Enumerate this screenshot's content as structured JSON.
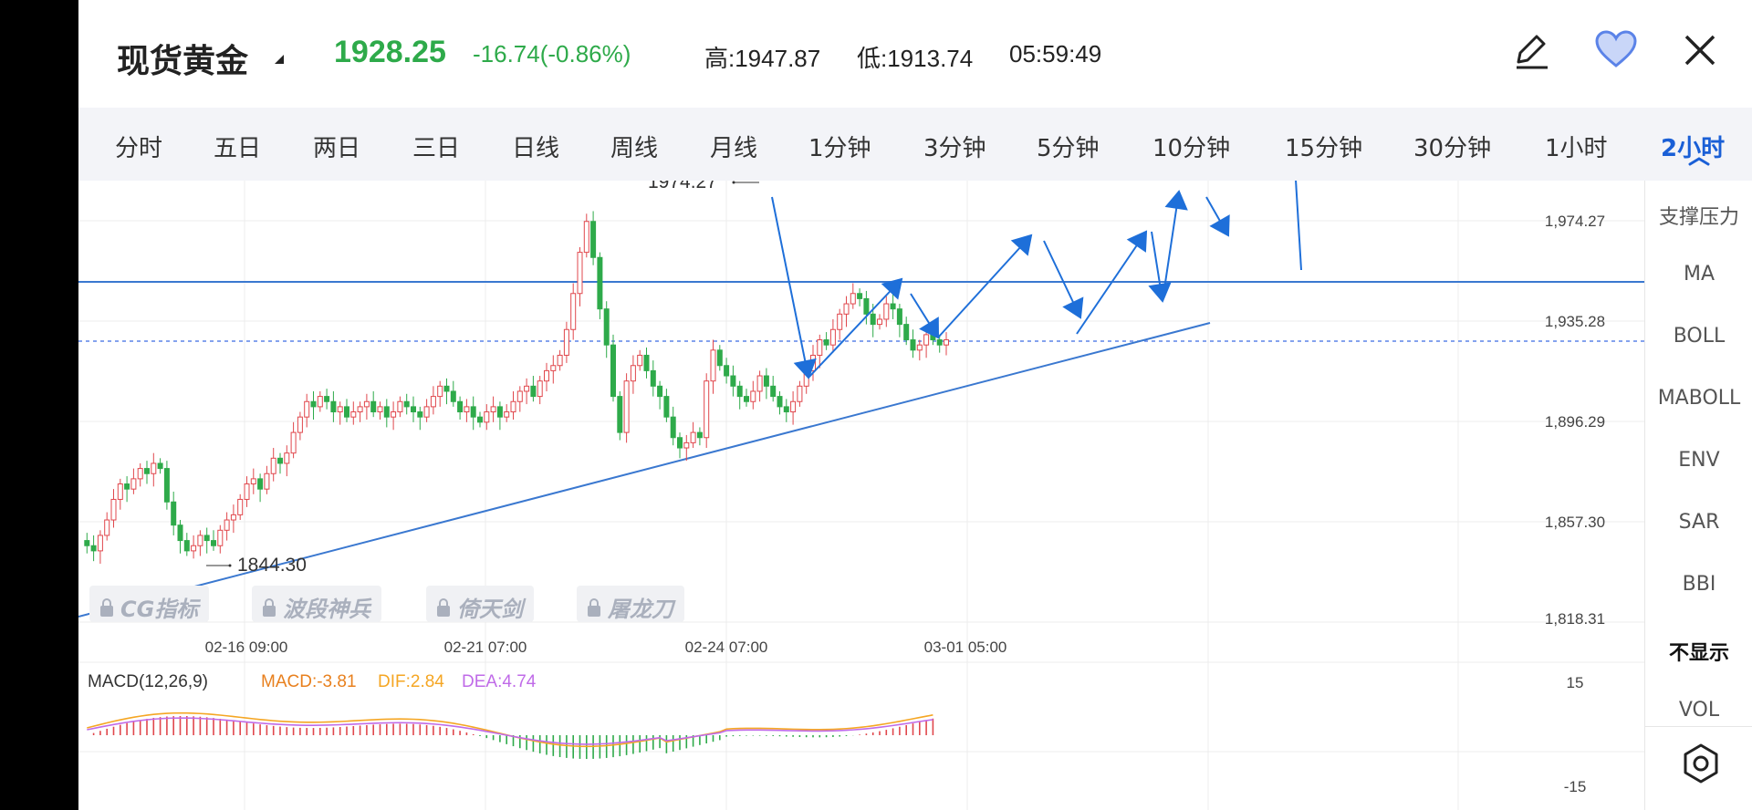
{
  "header": {
    "symbol": "现货黄金",
    "price": "1928.25",
    "change": "-16.74(-0.86%)",
    "high": "高:1947.87",
    "low": "低:1913.74",
    "time": "05:59:49",
    "icons": [
      "edit-icon",
      "heart-icon",
      "close-icon"
    ],
    "up_color": "#2eaa4a"
  },
  "tabs": [
    "分时",
    "五日",
    "两日",
    "三日",
    "日线",
    "周线",
    "月线",
    "1分钟",
    "3分钟",
    "5分钟",
    "10分钟",
    "15分钟",
    "30分钟",
    "1小时",
    "2小时"
  ],
  "active_tab": "2小时",
  "side_panel": [
    "支撑压力",
    "MA",
    "BOLL",
    "MABOLL",
    "ENV",
    "SAR",
    "BBI",
    "不显示",
    "VOL"
  ],
  "indicator_buttons": [
    "CG指标",
    "波段神兵",
    "倚天剑",
    "屠龙刀"
  ],
  "chart": {
    "y_ticks": [
      "1,974.27",
      "1,935.28",
      "1,896.29",
      "1,857.30",
      "1,818.31"
    ],
    "x_ticks": [
      "02-16 09:00",
      "02-21 07:00",
      "02-24 07:00",
      "03-01 05:00"
    ],
    "max_label": "1974.27",
    "min_label": "1844.30",
    "macd_legend": {
      "title": "MACD(12,26,9)",
      "macd": "MACD:-3.81",
      "dif": "DIF:2.84",
      "dea": "DEA:4.74"
    },
    "macd_ticks": [
      "15",
      "-15"
    ],
    "colors": {
      "up": "#e0474c",
      "down": "#2eaa4a",
      "dif": "#f5a623",
      "dea": "#c06be8",
      "line": "#3a78d0",
      "arrow": "#1e6fd9"
    }
  }
}
